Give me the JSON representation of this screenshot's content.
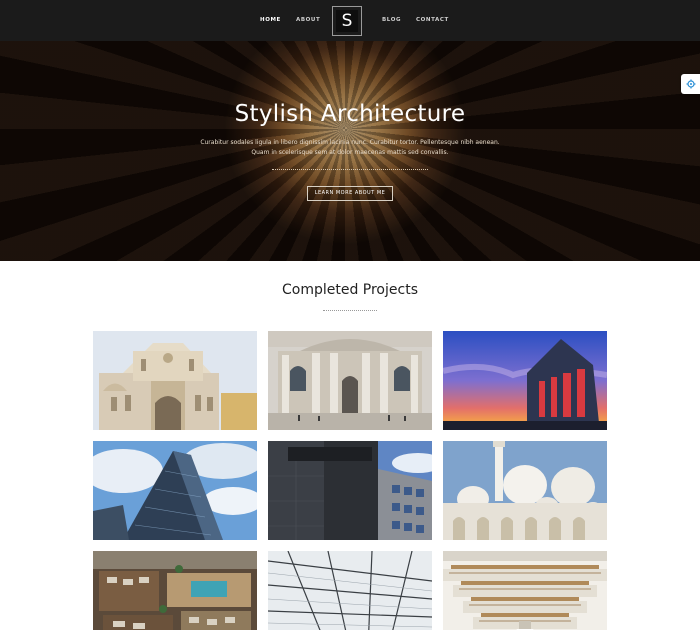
{
  "nav": {
    "items": [
      "HOME",
      "ABOUT",
      "BLOG",
      "CONTACT"
    ],
    "active": "HOME",
    "logo_letter": "S"
  },
  "hero": {
    "title": "Stylish Architecture",
    "text_line1": "Curabitur sodales ligula in libero dignissim lacinia nunc. Curabitur tortor. Pellentesque nibh aenean.",
    "text_line2": "Quam in scelerisque sem at dolor maecenas mattis sed convallis.",
    "button_label": "LEARN MORE ABOUT ME"
  },
  "settings_icon": "gear-icon",
  "projects": {
    "title": "Completed Projects",
    "tiles": [
      "cathedral-photo",
      "palace-facade-photo",
      "glass-concert-hall-sunset-photo",
      "glass-skyscraper-photo",
      "dark-modern-building-photo",
      "white-mosque-domes-photo",
      "rooftop-pool-aerial-photo",
      "glass-roof-atrium-photo",
      "library-interior-photo"
    ]
  },
  "colors": {
    "nav_bg": "#1b1b1b",
    "hero_warm": "#c19256",
    "text_dark": "#222222"
  }
}
